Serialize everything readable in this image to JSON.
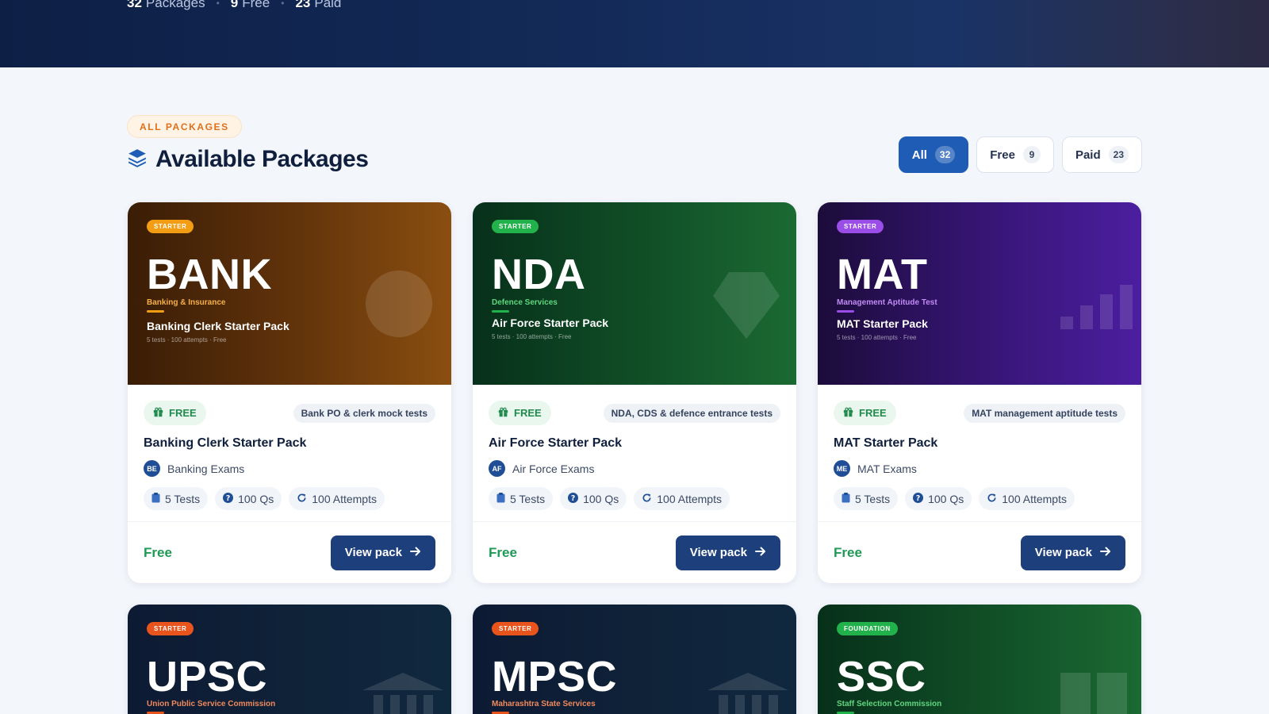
{
  "hero": {
    "packages_count": "32",
    "packages_label": "Packages",
    "free_count": "9",
    "free_label": "Free",
    "paid_count": "23",
    "paid_label": "Paid"
  },
  "section": {
    "eyebrow": "ALL PACKAGES",
    "title": "Available Packages",
    "icon": "layers-icon"
  },
  "filters": [
    {
      "label": "All",
      "count": "32",
      "active": true
    },
    {
      "label": "Free",
      "count": "9",
      "active": false
    },
    {
      "label": "Paid",
      "count": "23",
      "active": false
    }
  ],
  "cards": [
    {
      "tier": "STARTER",
      "code": "BANK",
      "subtitle": "Banking & Insurance",
      "banner_title": "Banking Clerk Starter Pack",
      "banner_meta": "5 tests · 100 attempts · Free",
      "free_label": "FREE",
      "tag": "Bank PO & clerk mock tests",
      "title": "Banking Clerk Starter Pack",
      "avatar": "BE",
      "exam": "Banking Exams",
      "tests": "5 Tests",
      "qs": "100 Qs",
      "attempts": "100 Attempts",
      "price": "Free",
      "cta": "View pack",
      "colors": {
        "tier": "#f29d13",
        "sub": "#f5b04a",
        "start": "#3a1d06",
        "end": "#8a4e10"
      }
    },
    {
      "tier": "STARTER",
      "code": "NDA",
      "subtitle": "Defence Services",
      "banner_title": "Air Force Starter Pack",
      "banner_meta": "5 tests · 100 attempts · Free",
      "free_label": "FREE",
      "tag": "NDA, CDS & defence entrance tests",
      "title": "Air Force Starter Pack",
      "avatar": "AF",
      "exam": "Air Force Exams",
      "tests": "5 Tests",
      "qs": "100 Qs",
      "attempts": "100 Attempts",
      "price": "Free",
      "cta": "View pack",
      "colors": {
        "tier": "#22b24c",
        "sub": "#5fd67f",
        "start": "#07301a",
        "end": "#1b6a32"
      }
    },
    {
      "tier": "STARTER",
      "code": "MAT",
      "subtitle": "Management Aptitude Test",
      "banner_title": "MAT Starter Pack",
      "banner_meta": "5 tests · 100 attempts · Free",
      "free_label": "FREE",
      "tag": "MAT management aptitude tests",
      "title": "MAT Starter Pack",
      "avatar": "ME",
      "exam": "MAT Exams",
      "tests": "5 Tests",
      "qs": "100 Qs",
      "attempts": "100 Attempts",
      "price": "Free",
      "cta": "View pack",
      "colors": {
        "tier": "#9b4de8",
        "sub": "#c18bf5",
        "start": "#1c0c3a",
        "end": "#4c1ea0"
      }
    },
    {
      "tier": "STARTER",
      "code": "UPSC",
      "subtitle": "Union Public Service Commission",
      "colors": {
        "tier": "#e8541c",
        "sub": "#f08a5c",
        "start": "#0d1a33",
        "end": "#10283e"
      }
    },
    {
      "tier": "STARTER",
      "code": "MPSC",
      "subtitle": "Maharashtra State Services",
      "colors": {
        "tier": "#e8541c",
        "sub": "#f08a5c",
        "start": "#0d1a33",
        "end": "#10283e"
      }
    },
    {
      "tier": "FOUNDATION",
      "code": "SSC",
      "subtitle": "Staff Selection Commission",
      "colors": {
        "tier": "#22b24c",
        "sub": "#5fd67f",
        "start": "#07301a",
        "end": "#1b6a32"
      }
    }
  ]
}
